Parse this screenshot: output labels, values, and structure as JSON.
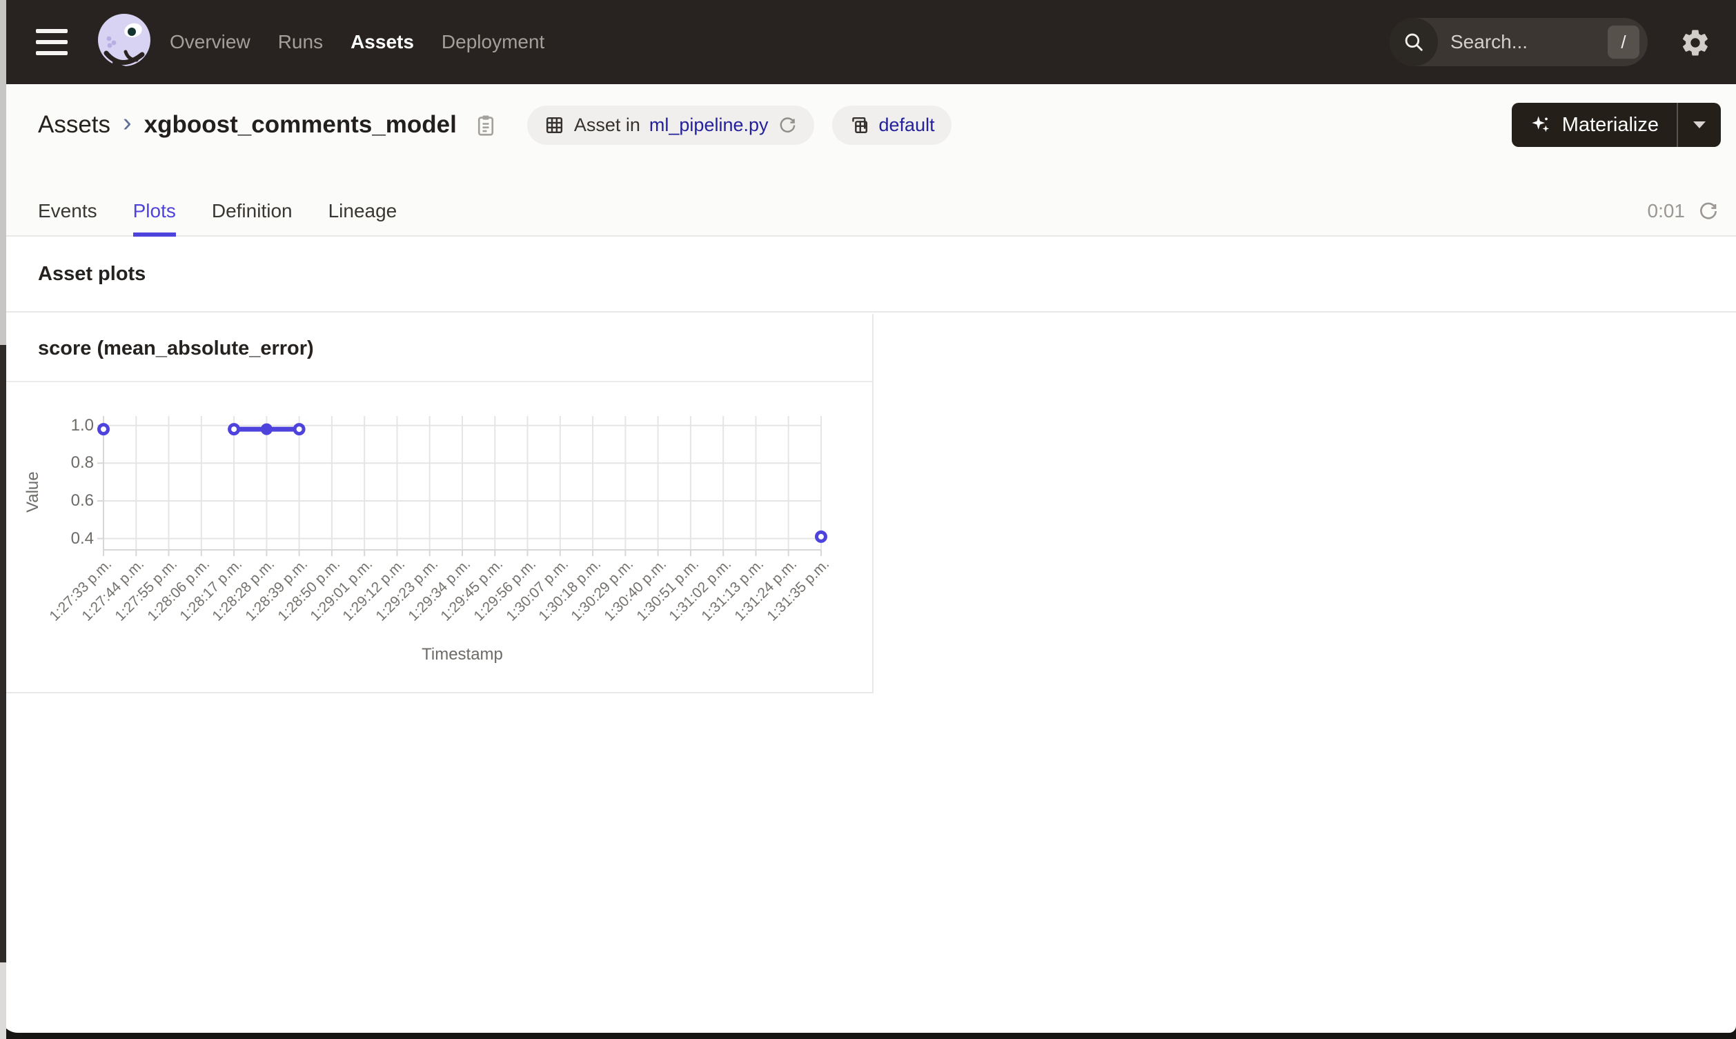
{
  "nav": {
    "items": [
      {
        "label": "Overview",
        "active": false
      },
      {
        "label": "Runs",
        "active": false
      },
      {
        "label": "Assets",
        "active": true
      },
      {
        "label": "Deployment",
        "active": false
      }
    ],
    "search": {
      "placeholder": "Search...",
      "shortcut": "/"
    }
  },
  "breadcrumb": {
    "root": "Assets",
    "separator": "›",
    "current": "xgboost_comments_model"
  },
  "header": {
    "tags": [
      {
        "icon": "table-grid-icon",
        "prefix": "Asset in",
        "link": "ml_pipeline.py",
        "has_refresh": true
      },
      {
        "icon": "workspace-icon",
        "prefix": "",
        "link": "default",
        "has_refresh": false
      }
    ],
    "materialize_label": "Materialize"
  },
  "tabs": {
    "items": [
      {
        "label": "Events",
        "active": false
      },
      {
        "label": "Plots",
        "active": true
      },
      {
        "label": "Definition",
        "active": false
      },
      {
        "label": "Lineage",
        "active": false
      }
    ],
    "refresh_timer": "0:01"
  },
  "section_title": "Asset plots",
  "chart_card": {
    "title": "score (mean_absolute_error)"
  },
  "chart_data": {
    "type": "line",
    "title": "score (mean_absolute_error)",
    "xlabel": "Timestamp",
    "ylabel": "Value",
    "x_ticks": [
      "1:27:33 p.m.",
      "1:27:44 p.m.",
      "1:27:55 p.m.",
      "1:28:06 p.m.",
      "1:28:17 p.m.",
      "1:28:28 p.m.",
      "1:28:39 p.m.",
      "1:28:50 p.m.",
      "1:29:01 p.m.",
      "1:29:12 p.m.",
      "1:29:23 p.m.",
      "1:29:34 p.m.",
      "1:29:45 p.m.",
      "1:29:56 p.m.",
      "1:30:07 p.m.",
      "1:30:18 p.m.",
      "1:30:29 p.m.",
      "1:30:40 p.m.",
      "1:30:51 p.m.",
      "1:31:02 p.m.",
      "1:31:13 p.m.",
      "1:31:24 p.m.",
      "1:31:35 p.m."
    ],
    "y_ticks": [
      1.0,
      0.8,
      0.6,
      0.4
    ],
    "y_tick_labels": [
      "1.0",
      "0.8",
      "0.6",
      "0.4"
    ],
    "ylim": [
      0.34,
      1.05
    ],
    "grid": true,
    "legend": "none",
    "series": [
      {
        "name": "score",
        "color": "#4f43dd",
        "points": [
          {
            "x": "1:27:33 p.m.",
            "y": 0.98,
            "marker": "hollow"
          },
          {
            "x": "1:28:17 p.m.",
            "y": 0.98,
            "marker": "hollow"
          },
          {
            "x": "1:28:28 p.m.",
            "y": 0.98,
            "marker": "filled"
          },
          {
            "x": "1:28:39 p.m.",
            "y": 0.98,
            "marker": "hollow"
          },
          {
            "x": "1:31:35 p.m.",
            "y": 0.41,
            "marker": "hollow"
          }
        ],
        "segments": [
          [
            1,
            2,
            3
          ]
        ]
      }
    ]
  },
  "colors": {
    "accent": "#4f43dd",
    "link": "#23219b",
    "nav_bg": "#282320",
    "grid": "#e6e5e4",
    "axis": "#d8d7d6"
  }
}
